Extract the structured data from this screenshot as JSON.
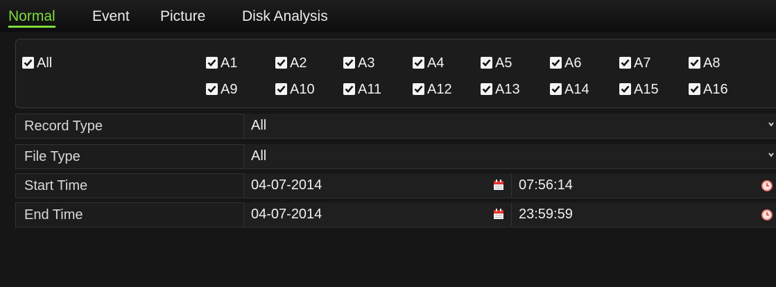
{
  "tabs": [
    {
      "label": "Normal"
    },
    {
      "label": "Event"
    },
    {
      "label": "Picture"
    },
    {
      "label": "Disk Analysis"
    }
  ],
  "channels": {
    "all_label": "All",
    "items": [
      "A1",
      "A2",
      "A3",
      "A4",
      "A5",
      "A6",
      "A7",
      "A8",
      "A9",
      "A10",
      "A11",
      "A12",
      "A13",
      "A14",
      "A15",
      "A16"
    ]
  },
  "form": {
    "record_type": {
      "label": "Record Type",
      "value": "All"
    },
    "file_type": {
      "label": "File Type",
      "value": "All"
    },
    "start_time": {
      "label": "Start Time",
      "date": "04-07-2014",
      "time": "07:56:14"
    },
    "end_time": {
      "label": "End Time",
      "date": "04-07-2014",
      "time": "23:59:59"
    }
  },
  "colors": {
    "active_tab": "#7ddc3a",
    "background": "#161616",
    "calendar_icon": "#e8302a",
    "clock_icon": "#f07a72"
  },
  "icons": [
    "checkbox-checked-icon",
    "chevron-down-icon",
    "calendar-icon",
    "clock-icon"
  ]
}
